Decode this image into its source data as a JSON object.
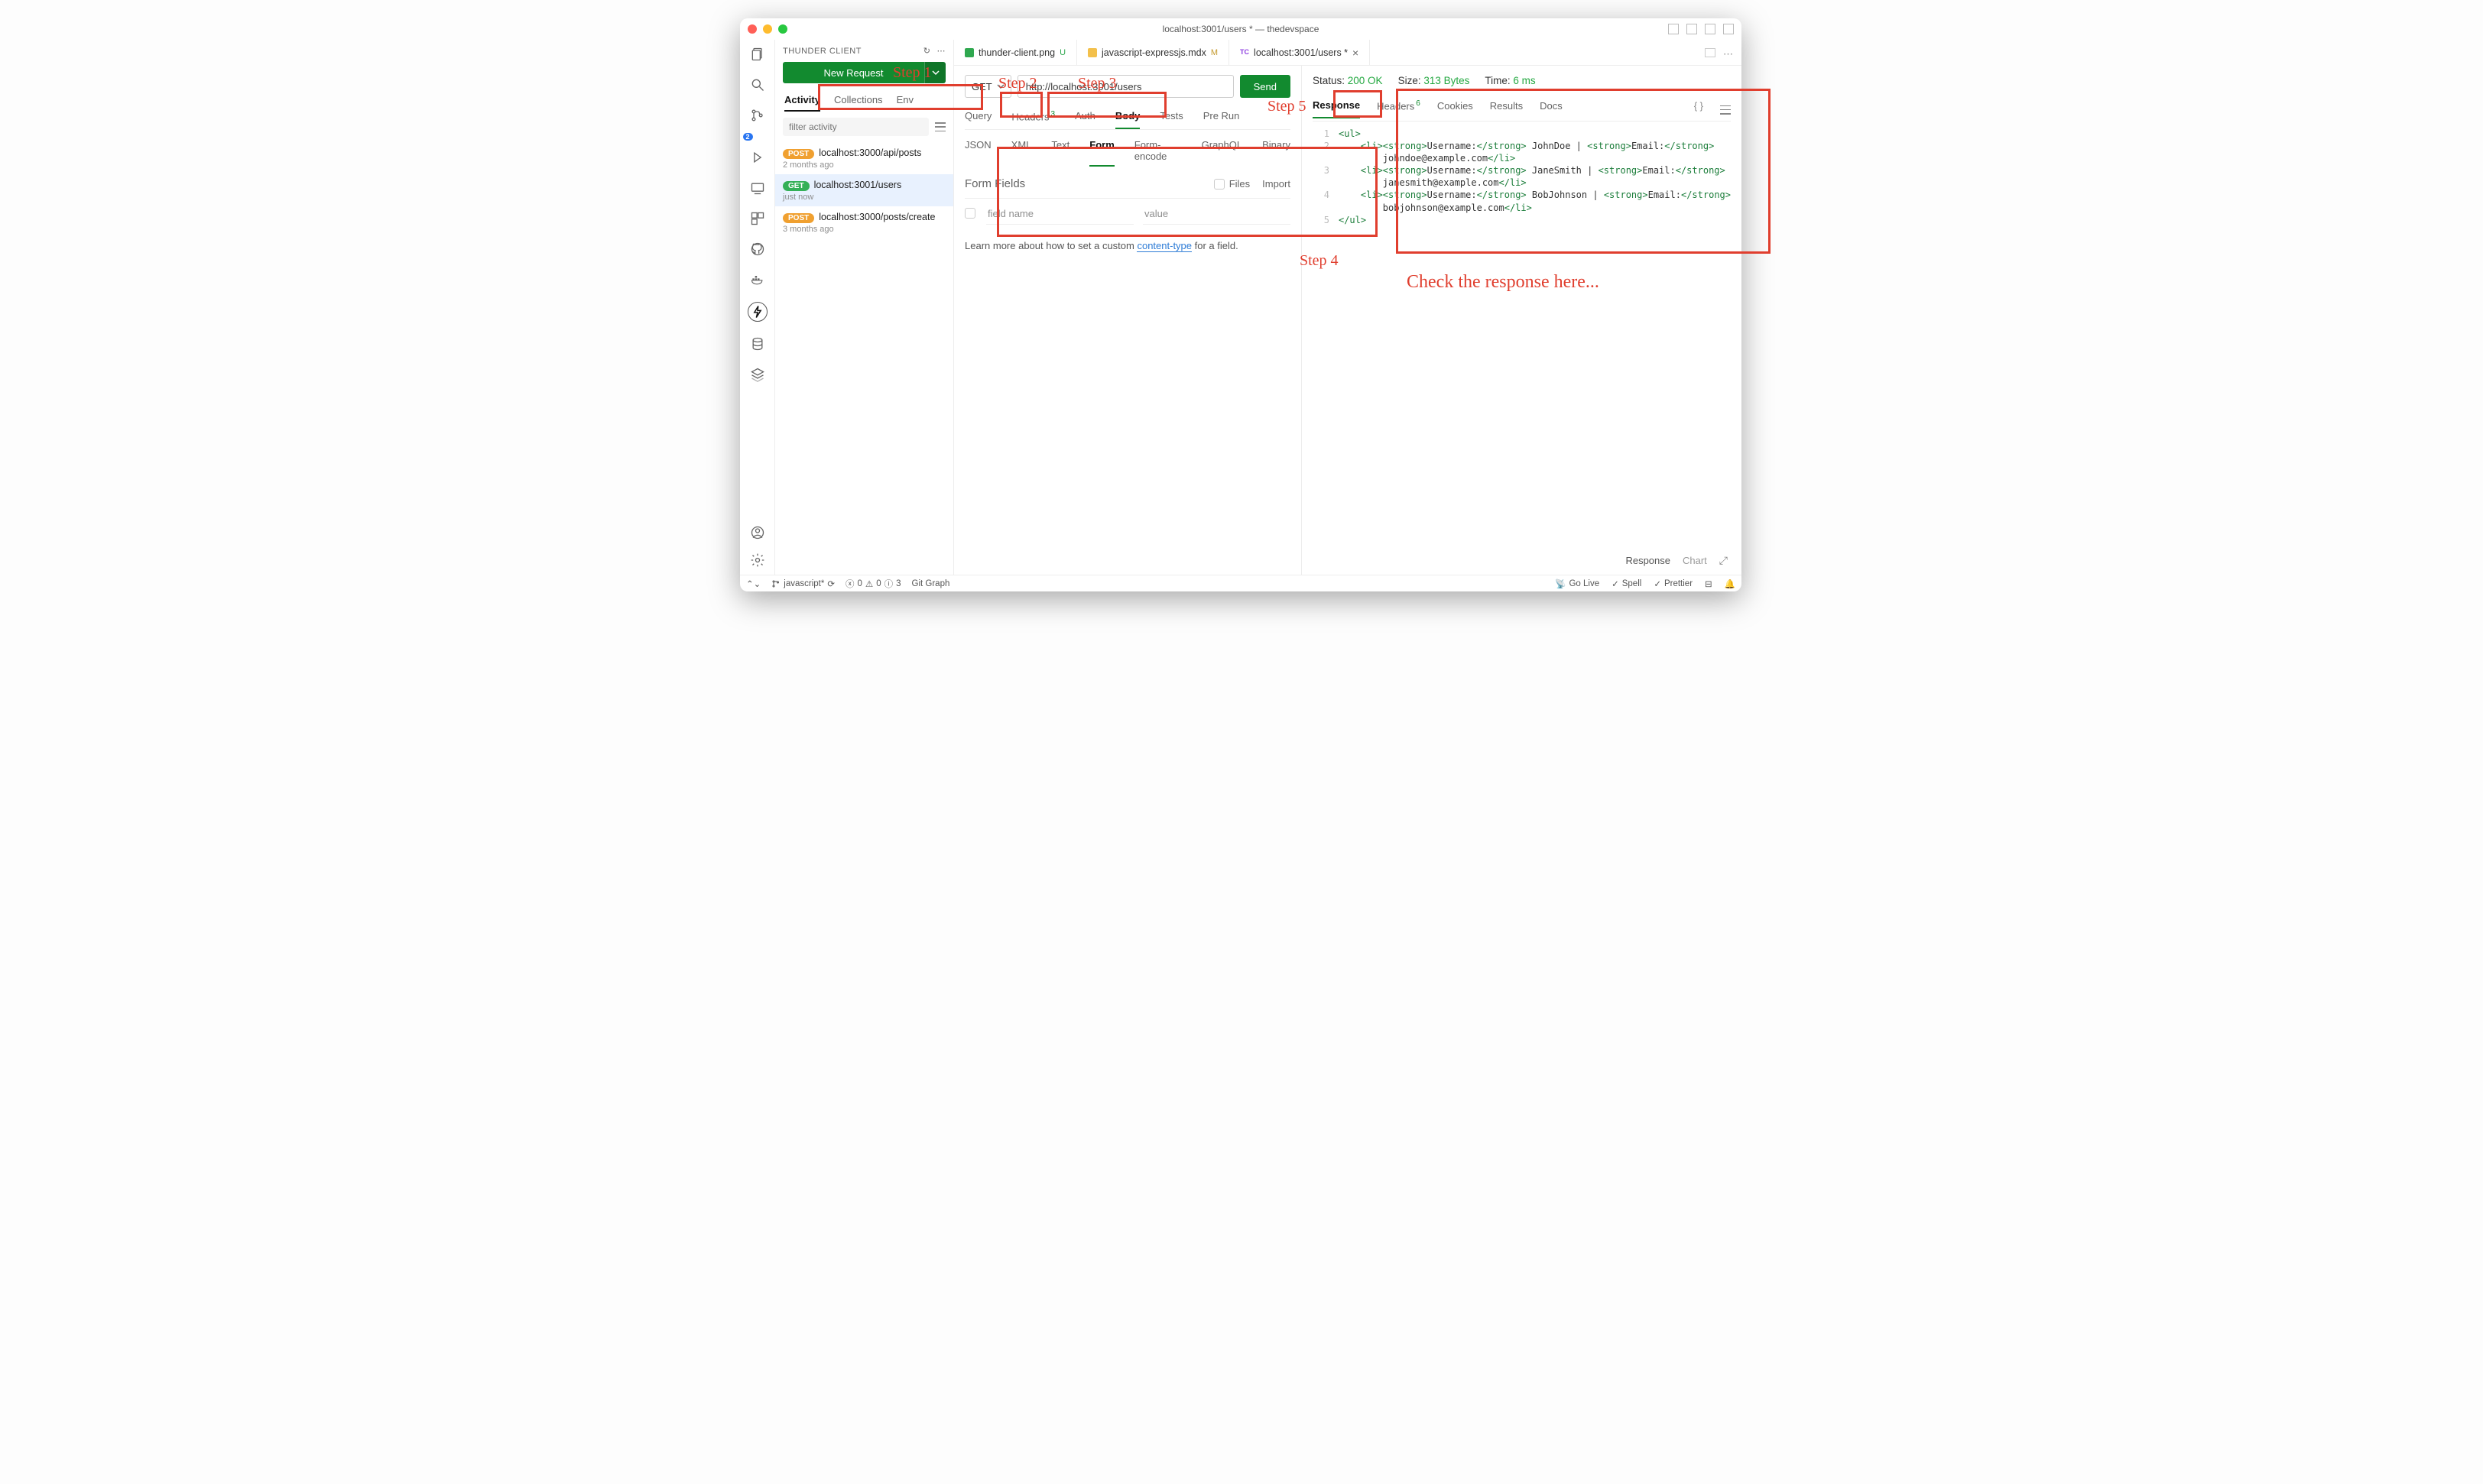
{
  "window_title": "localhost:3001/users * — thedevspace",
  "activitybar": {
    "scm_badge": "2"
  },
  "sidebar": {
    "title": "THUNDER CLIENT",
    "new_request": "New Request",
    "tabs": {
      "activity": "Activity",
      "collections": "Collections",
      "env": "Env"
    },
    "filter_placeholder": "filter activity",
    "items": [
      {
        "method": "POST",
        "url": "localhost:3000/api/posts",
        "time": "2 months ago",
        "selected": false
      },
      {
        "method": "GET",
        "url": "localhost:3001/users",
        "time": "just now",
        "selected": true
      },
      {
        "method": "POST",
        "url": "localhost:3000/posts/create",
        "time": "3 months ago",
        "selected": false
      }
    ]
  },
  "tabs": [
    {
      "label": "thunder-client.png",
      "suffix": "U",
      "ic": "img",
      "active": false
    },
    {
      "label": "javascript-expressjs.mdx",
      "suffix": "M",
      "ic": "mdx",
      "active": false
    },
    {
      "label": "localhost:3001/users *",
      "suffix": "",
      "ic": "tc",
      "active": true,
      "closable": true
    }
  ],
  "request": {
    "method": "GET",
    "url": "http://localhost:3001/users",
    "send": "Send",
    "subtabs": {
      "query": "Query",
      "headers": "Headers",
      "headers_n": "3",
      "auth": "Auth",
      "body": "Body",
      "tests": "Tests",
      "prerun": "Pre Run"
    },
    "bodytabs": {
      "json": "JSON",
      "xml": "XML",
      "text": "Text",
      "form": "Form",
      "formenc": "Form-encode",
      "graphql": "GraphQL",
      "binary": "Binary"
    },
    "form_fields_label": "Form Fields",
    "files": "Files",
    "import": "Import",
    "ff_name": "field name",
    "ff_value": "value",
    "learn_pre": "Learn more about how to set a custom ",
    "learn_link": "content-type",
    "learn_post": " for a field."
  },
  "response": {
    "status_l": "Status:",
    "status_v": "200 OK",
    "size_l": "Size:",
    "size_v": "313 Bytes",
    "time_l": "Time:",
    "time_v": "6 ms",
    "tabs": {
      "response": "Response",
      "headers": "Headers",
      "headers_n": "6",
      "cookies": "Cookies",
      "results": "Results",
      "docs": "Docs"
    },
    "code": [
      {
        "n": "1",
        "html": "<span class='tag'>&lt;ul&gt;</span>"
      },
      {
        "n": "2",
        "html": "    <span class='tag'>&lt;li&gt;&lt;strong&gt;</span><span class='txt'>Username:</span><span class='tag'>&lt;/strong&gt;</span><span class='txt'> JohnDoe | </span><span class='tag'>&lt;strong&gt;</span><span class='txt'>Email:</span><span class='tag'>&lt;/strong&gt;</span>"
      },
      {
        "n": "",
        "html": "        <span class='txt'>johndoe@example.com</span><span class='tag'>&lt;/li&gt;</span>"
      },
      {
        "n": "3",
        "html": "    <span class='tag'>&lt;li&gt;&lt;strong&gt;</span><span class='txt'>Username:</span><span class='tag'>&lt;/strong&gt;</span><span class='txt'> JaneSmith | </span><span class='tag'>&lt;strong&gt;</span><span class='txt'>Email:</span><span class='tag'>&lt;/strong&gt;</span>"
      },
      {
        "n": "",
        "html": "        <span class='txt'>janesmith@example.com</span><span class='tag'>&lt;/li&gt;</span>"
      },
      {
        "n": "4",
        "html": "    <span class='tag'>&lt;li&gt;&lt;strong&gt;</span><span class='txt'>Username:</span><span class='tag'>&lt;/strong&gt;</span><span class='txt'> BobJohnson | </span><span class='tag'>&lt;strong&gt;</span><span class='txt'>Email:</span><span class='tag'>&lt;/strong&gt;</span>"
      },
      {
        "n": "",
        "html": "        <span class='txt'>bobjohnson@example.com</span><span class='tag'>&lt;/li&gt;</span>"
      },
      {
        "n": "5",
        "html": "<span class='tag'>&lt;/ul&gt;</span>"
      }
    ],
    "bottom": {
      "response": "Response",
      "chart": "Chart"
    }
  },
  "statusbar": {
    "branch": "javascript*",
    "errors": "0",
    "warns": "0",
    "infos": "3",
    "gitgraph": "Git Graph",
    "golive": "Go Live",
    "spell": "Spell",
    "prettier": "Prettier"
  },
  "annotations": {
    "s1": "Step 1",
    "s2": "Step 2",
    "s3": "Step 3",
    "s4": "Step 4",
    "s5": "Step 5",
    "resp": "Check the response here..."
  }
}
